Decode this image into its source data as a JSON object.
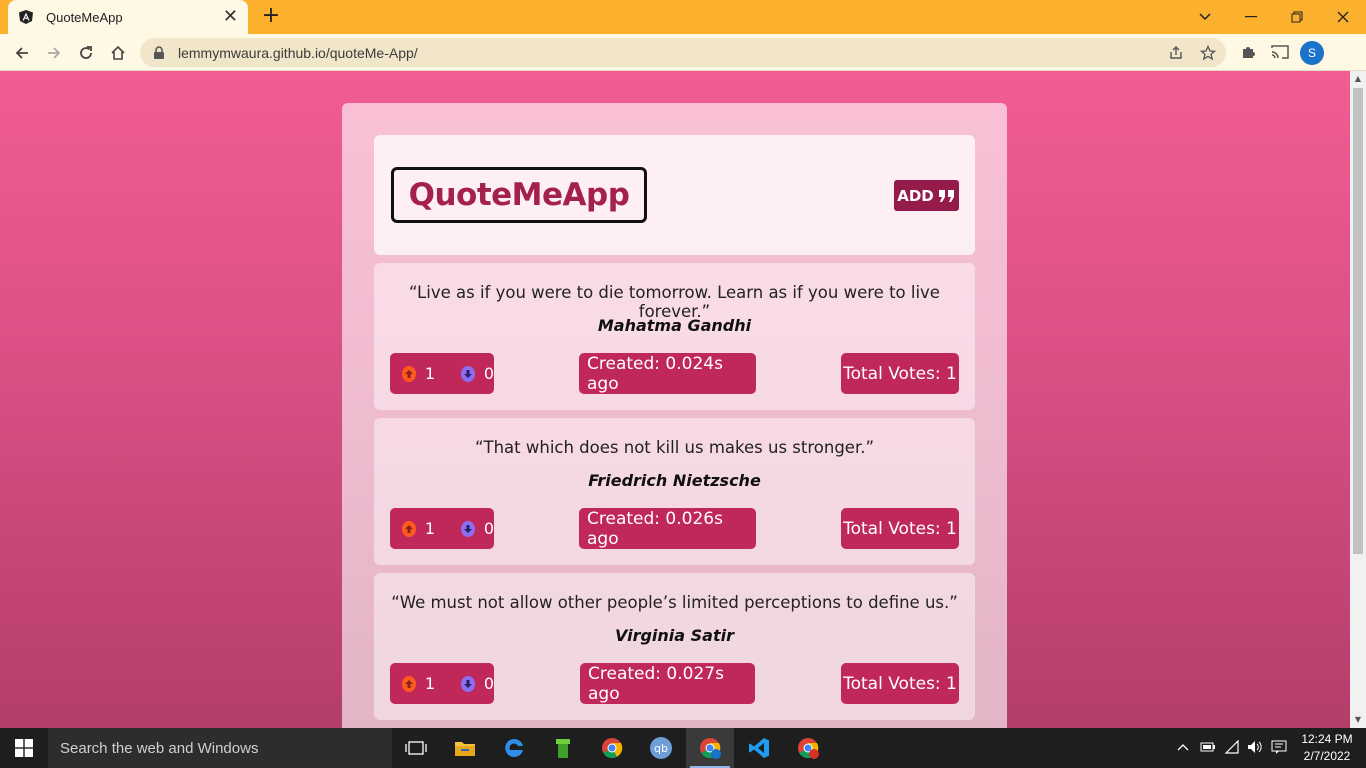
{
  "browser": {
    "tab_title": "QuoteMeApp",
    "url": "lemmymwaura.github.io/quoteMe-App/",
    "profile_initial": "S"
  },
  "app": {
    "logo": "QuoteMeApp",
    "add_label": "ADD"
  },
  "quotes": [
    {
      "text": "“Live as if you were to die tomorrow. Learn as if you were to live forever.”",
      "author": "Mahatma Gandhi",
      "upvotes": "1",
      "downvotes": "0",
      "created": "Created: 0.024s ago",
      "total": "Total Votes: 1"
    },
    {
      "text": "“That which does not kill us makes us stronger.”",
      "author": "Friedrich Nietzsche",
      "upvotes": "1",
      "downvotes": "0",
      "created": "Created: 0.026s ago",
      "total": "Total Votes: 1"
    },
    {
      "text": "“We must not allow other people’s limited perceptions to define us.”",
      "author": "Virginia Satir",
      "upvotes": "1",
      "downvotes": "0",
      "created": "Created: 0.027s ago",
      "total": "Total Votes: 1"
    }
  ],
  "taskbar": {
    "search_placeholder": "Search the web and Windows",
    "time": "12:24 PM",
    "date": "2/7/2022"
  },
  "colors": {
    "accent": "#c0285a",
    "brand": "#a4214f",
    "tabstrip": "#fbb02e"
  }
}
